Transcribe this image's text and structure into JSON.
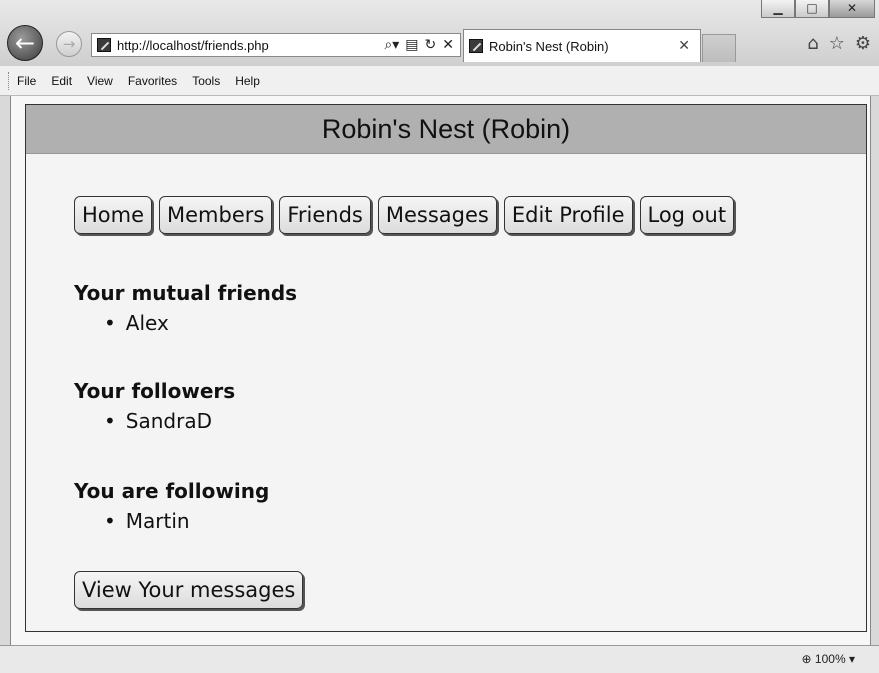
{
  "browser": {
    "url": "http://localhost/friends.php",
    "tab_title": "Robin's Nest (Robin)",
    "menu": [
      "File",
      "Edit",
      "View",
      "Favorites",
      "Tools",
      "Help"
    ],
    "zoom": "100%"
  },
  "site": {
    "header": "Robin's Nest (Robin)",
    "nav": [
      "Home",
      "Members",
      "Friends",
      "Messages",
      "Edit Profile",
      "Log out"
    ],
    "sections": [
      {
        "heading": "Your mutual friends",
        "items": [
          "Alex"
        ]
      },
      {
        "heading": "Your followers",
        "items": [
          "SandraD"
        ]
      },
      {
        "heading": "You are following",
        "items": [
          "Martin"
        ]
      }
    ],
    "view_messages": "View Your messages"
  }
}
